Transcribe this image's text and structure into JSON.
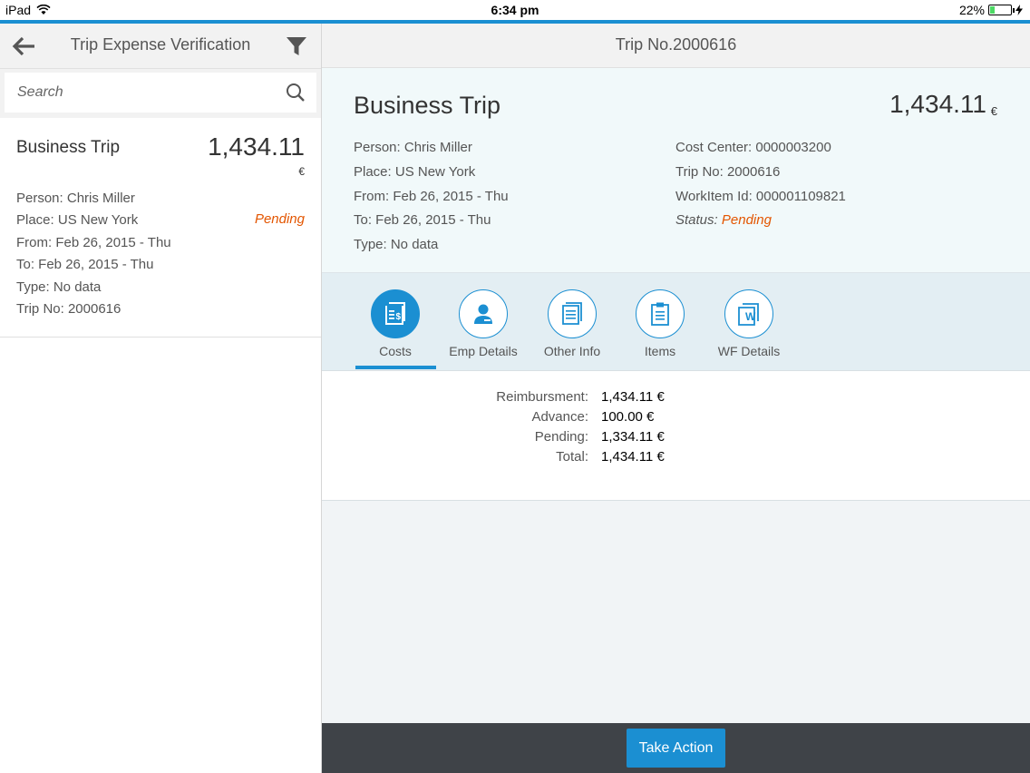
{
  "status_bar": {
    "device": "iPad",
    "time": "6:34 pm",
    "battery": "22%",
    "battery_level": 0.22
  },
  "master": {
    "title": "Trip Expense Verification",
    "search_placeholder": "Search",
    "items": [
      {
        "title": "Business Trip",
        "amount": "1,434.11",
        "currency": "€",
        "status": "Pending",
        "attributes": [
          "Person: Chris Miller",
          "Place: US New York",
          "From: Feb 26, 2015 - Thu",
          "To: Feb 26, 2015 - Thu",
          "Type: No data",
          "Trip No: 2000616"
        ]
      }
    ]
  },
  "detail": {
    "header_title": "Trip No.2000616",
    "object": {
      "title": "Business Trip",
      "amount": "1,434.11",
      "currency": "€",
      "left_attributes": [
        "Person: Chris Miller",
        "Place: US New York",
        "From: Feb 26, 2015 - Thu",
        "To: Feb 26, 2015 - Thu",
        "Type: No data"
      ],
      "right_attributes": [
        "Cost Center: 0000003200",
        "Trip No: 2000616",
        "WorkItem Id: 000001109821"
      ],
      "status_label": "Status:",
      "status_value": "Pending"
    },
    "tabs": [
      {
        "label": "Costs",
        "icon": "document-money-icon",
        "active": true
      },
      {
        "label": "Emp Details",
        "icon": "employee-icon",
        "active": false
      },
      {
        "label": "Other Info",
        "icon": "document-icon",
        "active": false
      },
      {
        "label": "Items",
        "icon": "clipboard-icon",
        "active": false
      },
      {
        "label": "WF Details",
        "icon": "workflow-document-icon",
        "active": false
      }
    ],
    "costs": [
      {
        "label": "Reimbursment:",
        "value": "1,434.11 €"
      },
      {
        "label": "Advance:",
        "value": "100.00 €"
      },
      {
        "label": "Pending:",
        "value": "1,334.11 €"
      },
      {
        "label": "Total:",
        "value": "1,434.11 €"
      }
    ]
  },
  "footer": {
    "take_action_label": "Take Action"
  },
  "colors": {
    "accent": "#1b8fd2",
    "status_pending": "#e35500",
    "footer_bg": "#3f4348"
  }
}
